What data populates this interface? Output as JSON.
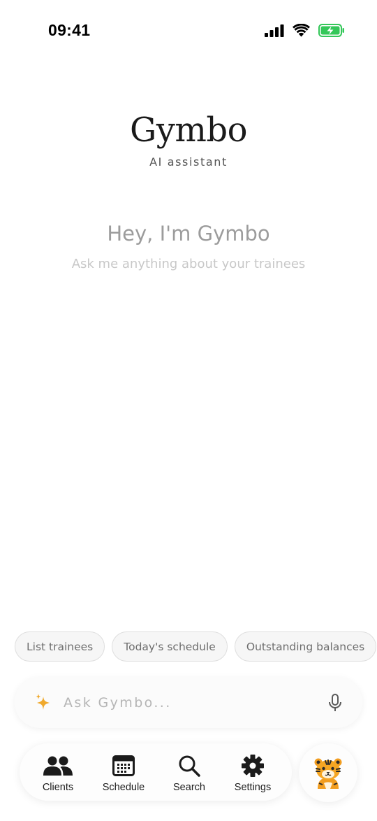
{
  "status_bar": {
    "time": "09:41",
    "icons": [
      "cellular-signal-icon",
      "wifi-icon",
      "battery-charging-icon"
    ],
    "battery_color": "#34c759"
  },
  "header": {
    "title": "Gymbo",
    "subtitle": "AI assistant"
  },
  "greeting": {
    "title": "Hey, I'm Gymbo",
    "subtitle": "Ask me anything about your trainees"
  },
  "suggestions": [
    {
      "label": "List trainees"
    },
    {
      "label": "Today's schedule"
    },
    {
      "label": "Outstanding balances"
    }
  ],
  "input": {
    "placeholder": "Ask Gymbo...",
    "value": "",
    "leading_icon": "sparkle-icon",
    "trailing_icon": "microphone-icon",
    "accent_color": "#f0a92c"
  },
  "nav": {
    "items": [
      {
        "label": "Clients",
        "icon": "clients-icon"
      },
      {
        "label": "Schedule",
        "icon": "calendar-icon"
      },
      {
        "label": "Search",
        "icon": "search-icon"
      },
      {
        "label": "Settings",
        "icon": "gear-icon"
      }
    ],
    "mascot_icon": "tiger-icon"
  }
}
